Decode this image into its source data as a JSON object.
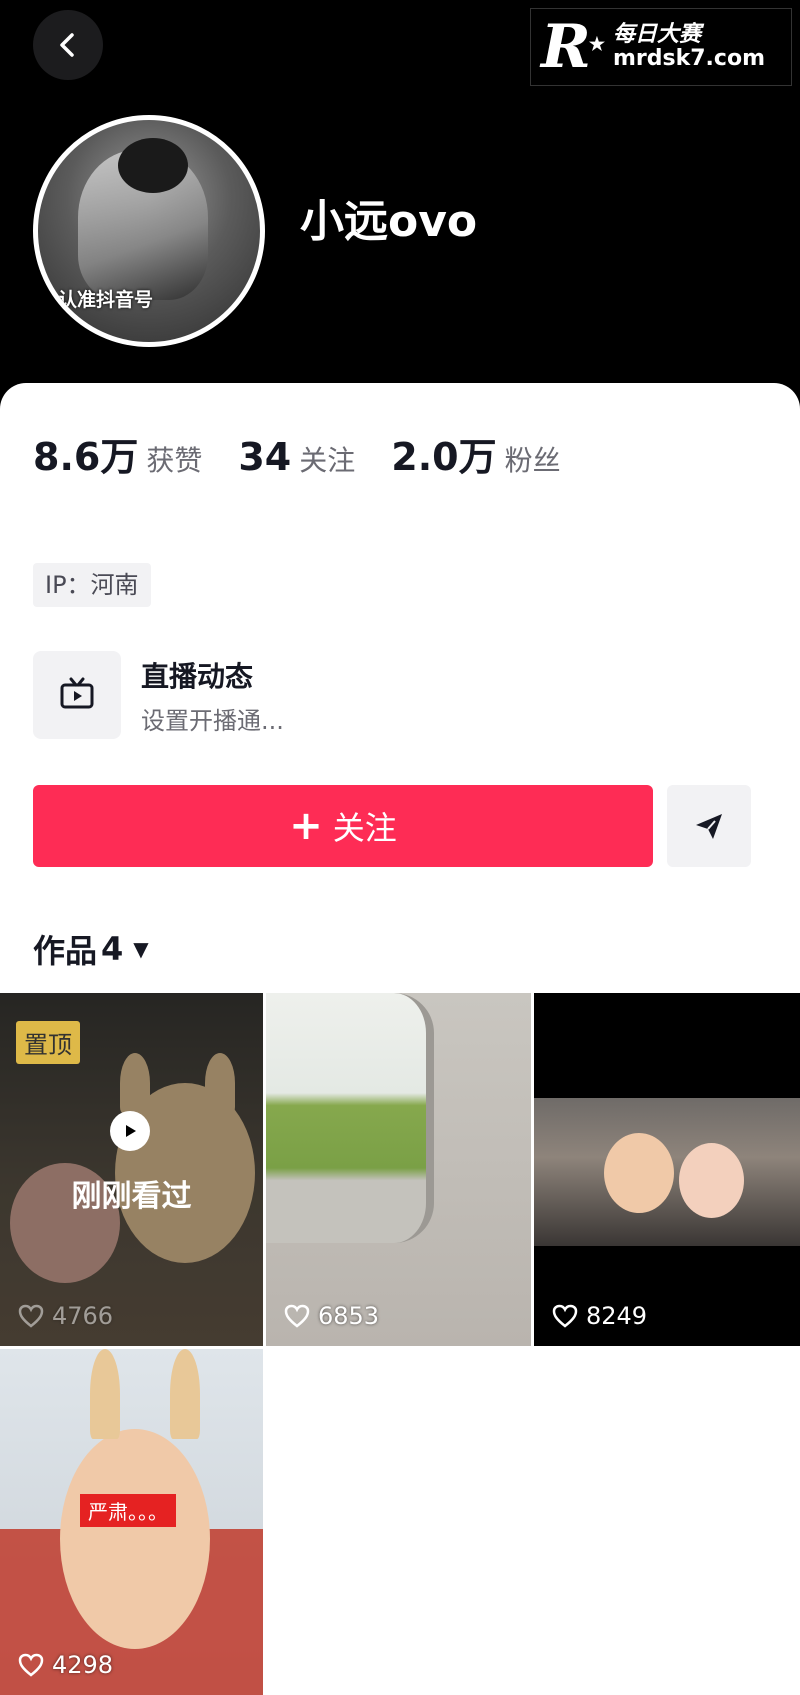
{
  "header": {
    "back_icon": "chevron-left-icon",
    "watermark": {
      "logo": "R",
      "line1": "每日大赛",
      "line2": "mrdsk7.com"
    },
    "avatar_caption": "认准抖音号",
    "username": "小远ovo"
  },
  "stats": [
    {
      "value": "8.6万",
      "label": "获赞"
    },
    {
      "value": "34",
      "label": "关注"
    },
    {
      "value": "2.0万",
      "label": "粉丝"
    }
  ],
  "ip": "IP：河南",
  "live": {
    "icon": "tv-icon",
    "title": "直播动态",
    "subtitle": "设置开播通..."
  },
  "actions": {
    "follow_label": "关注",
    "share_icon": "send-icon"
  },
  "works": {
    "label": "作品",
    "count": "4"
  },
  "videos": [
    {
      "pinned_label": "置顶",
      "watched_label": "刚刚看过",
      "likes": "4766"
    },
    {
      "likes": "6853"
    },
    {
      "likes": "8249"
    },
    {
      "sticker_text": "严肃。。。",
      "likes": "4298"
    }
  ],
  "colors": {
    "accent": "#fe2c55",
    "header_bg": "#000000"
  }
}
